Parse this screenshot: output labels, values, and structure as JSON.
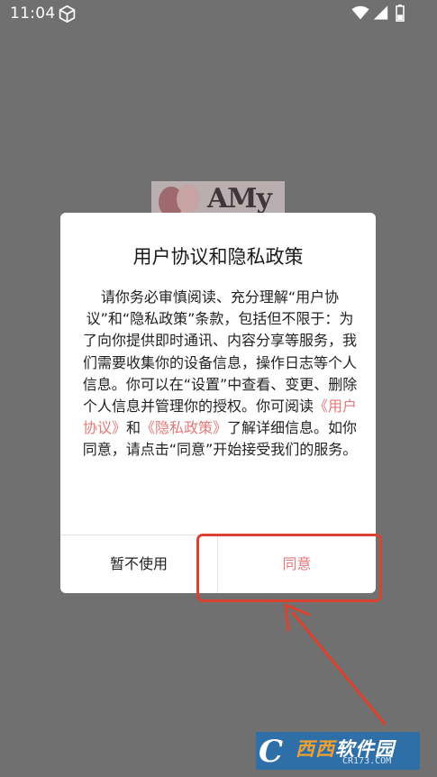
{
  "status_bar": {
    "time": "11:04",
    "icons": [
      "cube-icon",
      "wifi-icon",
      "signal-icon",
      "battery-icon"
    ]
  },
  "background": {
    "logo_text": "AMy"
  },
  "dialog": {
    "title": "用户协议和隐私政策",
    "body": {
      "text_1": "请你务必审慎阅读、充分理解“用户协议”和“隐私政策”条款，包括但不限于：为了向你提供即时通讯、内容分享等服务，我们需要收集你的设备信息，操作日志等个人信息。你可以在“设置”中查看、变更、删除个人信息并管理你的授权。你可阅读",
      "link_user_agreement": "《用户协议》",
      "and": "和",
      "link_privacy_policy": "《隐私政策》",
      "text_2": "了解详细信息。如你同意，请点击“同意”开始接受我们的服务。"
    },
    "decline_button": "暂不使用",
    "agree_button": "同意"
  },
  "watermark": {
    "mark": "C",
    "name_highlight": "西西",
    "name_rest": "软件园",
    "url": "CR173.COM"
  },
  "colors": {
    "overlay": "#707070",
    "accent_link": "#e57878",
    "annotation_red": "#d9422e",
    "watermark_blue": "#2f6fa8"
  }
}
